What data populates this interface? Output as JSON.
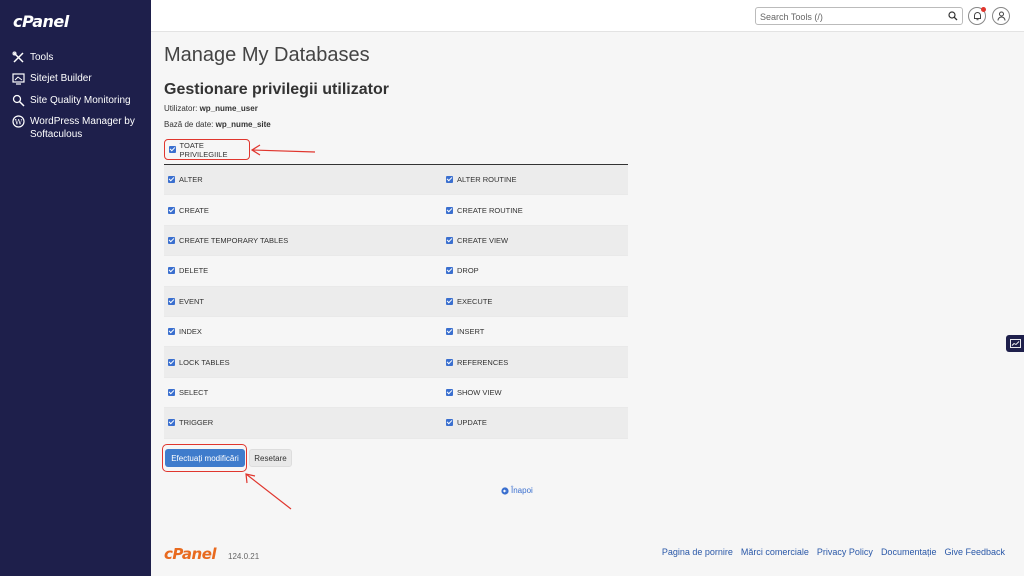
{
  "brand": {
    "logo": "cPanel"
  },
  "sidebar": {
    "items": [
      {
        "label": "Tools",
        "icon": "tools-icon"
      },
      {
        "label": "Sitejet Builder",
        "icon": "sitejet-icon"
      },
      {
        "label": "Site Quality Monitoring",
        "icon": "magnifier-icon"
      },
      {
        "label": "WordPress Manager by Softaculous",
        "icon": "wordpress-icon"
      }
    ]
  },
  "topbar": {
    "search_placeholder": "Search Tools (/)",
    "search_icon": "search-icon",
    "notification_icon": "bell-icon",
    "user_icon": "user-icon"
  },
  "main": {
    "page_title": "Manage My Databases",
    "section_title": "Gestionare privilegii utilizator",
    "user_label": "Utilizator:",
    "user_value": "wp_nume_user",
    "db_label": "Bază de date:",
    "db_value": "wp_nume_site",
    "all_privileges": {
      "label": "TOATE PRIVILEGIILE",
      "checked": true
    },
    "privileges": [
      [
        "ALTER",
        "ALTER ROUTINE"
      ],
      [
        "CREATE",
        "CREATE ROUTINE"
      ],
      [
        "CREATE TEMPORARY TABLES",
        "CREATE VIEW"
      ],
      [
        "DELETE",
        "DROP"
      ],
      [
        "EVENT",
        "EXECUTE"
      ],
      [
        "INDEX",
        "INSERT"
      ],
      [
        "LOCK TABLES",
        "REFERENCES"
      ],
      [
        "SELECT",
        "SHOW VIEW"
      ],
      [
        "TRIGGER",
        "UPDATE"
      ]
    ],
    "apply_button": "Efectuați modificări",
    "reset_button": "Resetare",
    "back_link": "Înapoi"
  },
  "footer": {
    "logo": "cPanel",
    "version": "124.0.21",
    "links": [
      "Pagina de pornire",
      "Mărci comerciale",
      "Privacy Policy",
      "Documentație",
      "Give Feedback"
    ]
  },
  "colors": {
    "sidebar": "#1e1f4b",
    "accent": "#3f7ccc",
    "annotation": "#e0362e",
    "footer_logo": "#e86a1f"
  }
}
